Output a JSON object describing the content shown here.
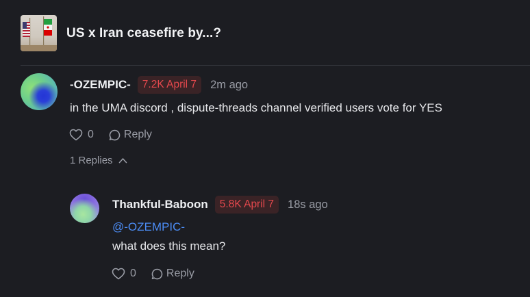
{
  "market": {
    "title": "US x Iran ceasefire by...?",
    "thumbnail_icon": "flags-icon"
  },
  "comments": [
    {
      "username": "-OZEMPIC-",
      "badge": "7.2K April 7",
      "time": "2m ago",
      "text": "in the UMA discord , dispute-threads channel verified users vote for YES",
      "likes": "0",
      "reply_label": "Reply",
      "replies_toggle": "1 Replies"
    }
  ],
  "replies": [
    {
      "username": "Thankful-Baboon",
      "badge": "5.8K April 7",
      "time": "18s ago",
      "mention": "@-OZEMPIC-",
      "text": "what does this mean?",
      "likes": "0",
      "reply_label": "Reply"
    }
  ],
  "colors": {
    "background": "#1c1d22",
    "badge_text": "#e5484d",
    "badge_bg": "#3a2326",
    "mention": "#4c8df6",
    "muted": "#9a9da6"
  }
}
